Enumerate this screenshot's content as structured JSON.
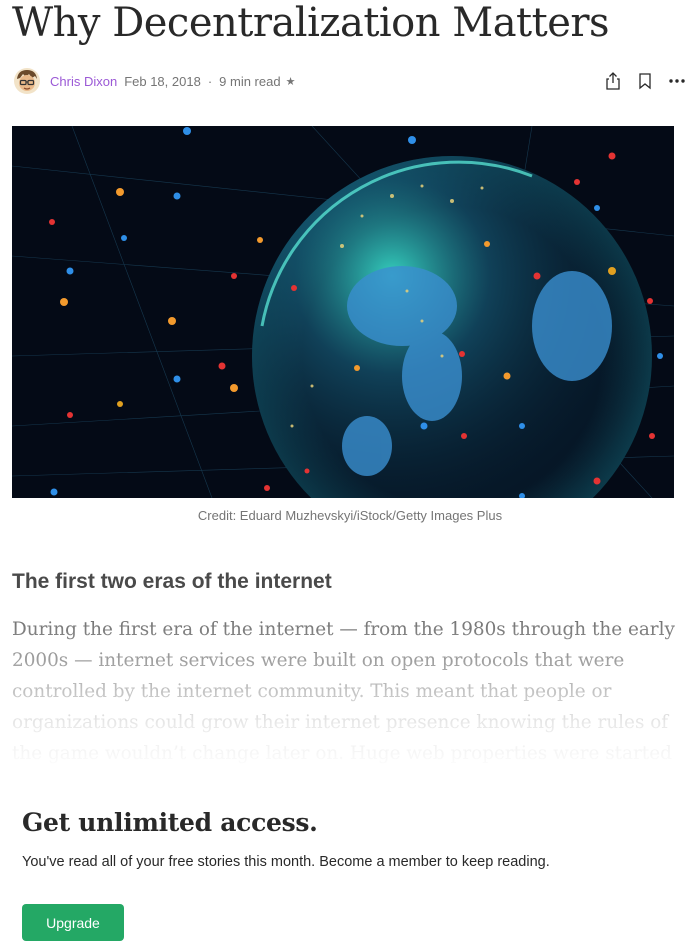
{
  "article": {
    "title": "Why Decentralization Matters",
    "author": "Chris Dixon",
    "date": "Feb 18, 2018",
    "separator": "·",
    "read_time": "9 min read",
    "member_star": "★"
  },
  "toolbar": {
    "share_icon": "share-icon",
    "bookmark_icon": "bookmark-icon",
    "more_icon": "more-options-icon"
  },
  "hero": {
    "caption": "Credit: Eduard Muzhevskyi/iStock/Getty Images Plus"
  },
  "section": {
    "heading": "The first two eras of the internet",
    "paragraph": "During the first era of the internet — from the 1980s through the early 2000s — internet services were built on open protocols that were controlled by the internet community. This meant that people or organizations could grow their internet presence knowing the rules of the game wouldn’t change later on. Huge web properties were started during this era…"
  },
  "paywall": {
    "heading": "Get unlimited access.",
    "message": "You've read all of your free stories this month. Become a member to keep reading.",
    "upgrade_label": "Upgrade"
  },
  "colors": {
    "author_link": "#9b59d6",
    "upgrade_button": "#24a865",
    "hero_background": "#050b18"
  }
}
